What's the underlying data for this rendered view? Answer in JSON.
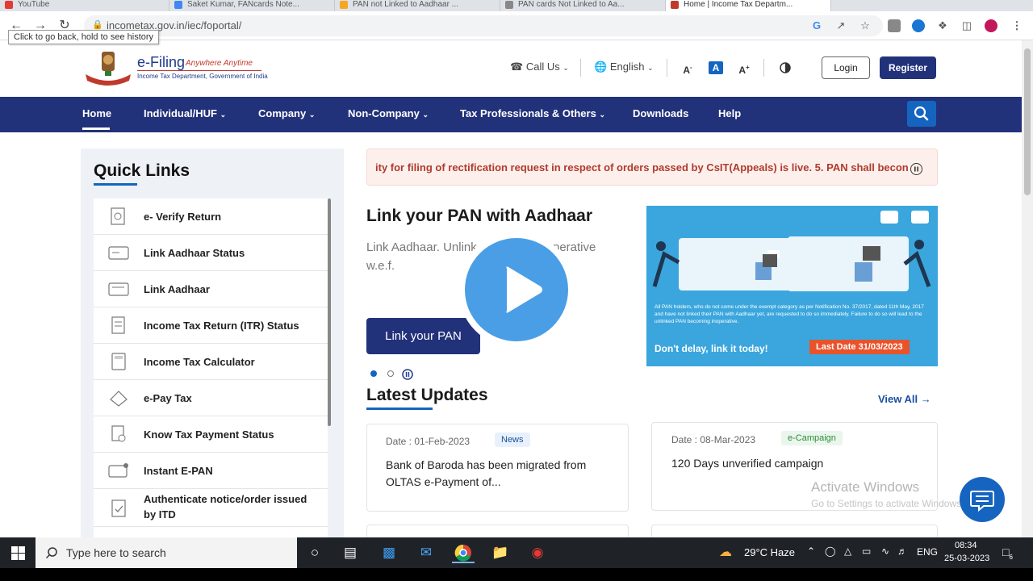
{
  "browser": {
    "tabs": [
      "YouTube",
      "Saket Kumar, FANcards Note...",
      "PAN not Linked to Aadhaar ...",
      "PAN cards Not Linked to Aa...",
      "Home | Income Tax Departm..."
    ],
    "url": "incometax.gov.in/iec/foportal/",
    "tooltip": "Click to go back, hold to see history"
  },
  "site": {
    "logo_title": "e-Filing",
    "logo_tagline": "Anywhere Anytime",
    "logo_dept": "Income Tax Department, Government of India",
    "call_us": "Call Us",
    "language": "English",
    "font_small": "A",
    "font_normal": "A",
    "font_large": "A",
    "login": "Login",
    "register": "Register"
  },
  "nav": {
    "items": [
      "Home",
      "Individual/HUF",
      "Company",
      "Non-Company",
      "Tax Professionals & Others",
      "Downloads",
      "Help"
    ]
  },
  "quick_links": {
    "title": "Quick Links",
    "items": [
      "e- Verify Return",
      "Link Aadhaar Status",
      "Link Aadhaar",
      "Income Tax Return (ITR) Status",
      "Income Tax Calculator",
      "e-Pay Tax",
      "Know Tax Payment Status",
      "Instant E-PAN",
      "Authenticate notice/order issued by ITD"
    ]
  },
  "ticker": "ity for filing of rectification request in respect of orders passed by CsIT(Appeals) is live. 5. PAN shall becon",
  "hero": {
    "title": "Link your PAN with Aadhaar",
    "desc": "Link Aadhaar. Unlink... become inoperative w.e.f.",
    "button": "Link your PAN",
    "banner_text": "All PAN holders, who do not come under the exempt category as per Notification No. 37/2017, dated 11th May, 2017 and have not linked their PAN with Aadhaar yet, are requested to do so immediately. Failure to do so will lead to the unlinked PAN becoming inoperative.",
    "banner_cta": "Don't delay, link it today!",
    "banner_date": "Last Date 31/03/2023"
  },
  "latest_updates": {
    "title": "Latest Updates",
    "view_all": "View All",
    "cards": [
      {
        "date": "Date : 01-Feb-2023",
        "badge": "News",
        "title": "Bank of Baroda has been migrated from OLTAS e-Payment of..."
      },
      {
        "date": "Date : 08-Mar-2023",
        "badge": "e-Campaign",
        "title": "120 Days unverified campaign"
      }
    ]
  },
  "watermark": {
    "line1": "Activate Windows",
    "line2": "Go to Settings to activate Windows."
  },
  "taskbar": {
    "search_placeholder": "Type here to search",
    "weather": "29°C  Haze",
    "lang": "ENG",
    "time": "08:34",
    "date": "25-03-2023",
    "notif_count": "6"
  },
  "colors": {
    "nav_bg": "#22327a",
    "accent_blue": "#1565c0",
    "ticker_text": "#b03a2e",
    "ecampaign_badge": "#2e8b3a"
  }
}
